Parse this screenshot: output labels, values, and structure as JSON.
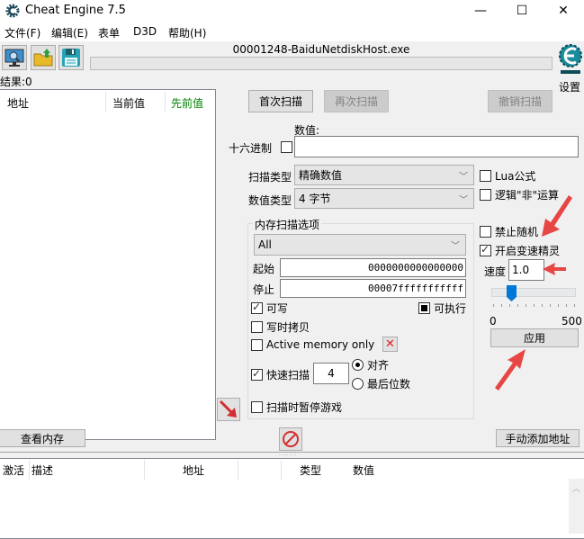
{
  "window": {
    "title": "Cheat Engine 7.5",
    "minimize_glyph": "—",
    "maximize_glyph": "☐",
    "close_glyph": "✕"
  },
  "menu": [
    "文件(F)",
    "编辑(E)",
    "表单",
    "D3D",
    "帮助(H)"
  ],
  "toolbar": {
    "process_title": "00001248-BaiduNetdiskHost.exe",
    "open_process_icon": "monitor-search-icon",
    "open_file_icon": "folder-open-icon",
    "save_icon": "floppy-disk-icon",
    "settings_label": "设置",
    "scan_progress": 0
  },
  "results": {
    "label": "结果:0",
    "columns": [
      "地址",
      "当前值",
      "先前值"
    ],
    "previous_value_color": "#008000",
    "rows": []
  },
  "scan": {
    "first_scan": "首次扫描",
    "next_scan": "再次扫描",
    "undo_scan": "撤销扫描",
    "value_label": "数值:",
    "hex_label": "十六进制",
    "hex_checked": false,
    "value": "",
    "scan_type_label": "扫描类型",
    "scan_type": "精确数值",
    "value_type_label": "数值类型",
    "value_type": "4 字节",
    "lua_formula": "Lua公式",
    "lua_checked": false,
    "logical_not": "逻辑\"非\"运算",
    "logical_not_checked": false
  },
  "memory_options": {
    "title": "内存扫描选项",
    "region": "All",
    "start_label": "起始",
    "start_value": "0000000000000000",
    "stop_label": "停止",
    "stop_value": "00007fffffffffff",
    "writable": "可写",
    "writable_checked": true,
    "executable": "可执行",
    "executable_state": "indeterminate",
    "copy_on_write": "写时拷贝",
    "copy_on_write_checked": false,
    "active_memory_only": "Active memory only",
    "active_memory_checked": false,
    "fast_scan": "快速扫描",
    "fast_scan_checked": true,
    "fast_scan_value": "4",
    "alignment": "对齐",
    "last_digits": "最后位数",
    "alignment_selected": "alignment",
    "pause_game": "扫描时暂停游戏",
    "pause_game_checked": false
  },
  "speedhack": {
    "disable_random": "禁止随机",
    "disable_random_checked": false,
    "enable_speedhack": "开启变速精灵",
    "enable_speedhack_checked": true,
    "speed_label": "速度",
    "speed_value": "1.0",
    "slider_min": "0",
    "slider_max": "500",
    "slider_fraction": 0.2,
    "apply": "应用"
  },
  "bottom": {
    "view_memory": "查看内存",
    "add_address": "手动添加地址",
    "cheat_columns": [
      "激活",
      "描述",
      "地址",
      "类型",
      "数值"
    ],
    "rows": []
  },
  "colors": {
    "annotation_arrow": "#e84545",
    "slider_thumb": "#0078d7"
  }
}
